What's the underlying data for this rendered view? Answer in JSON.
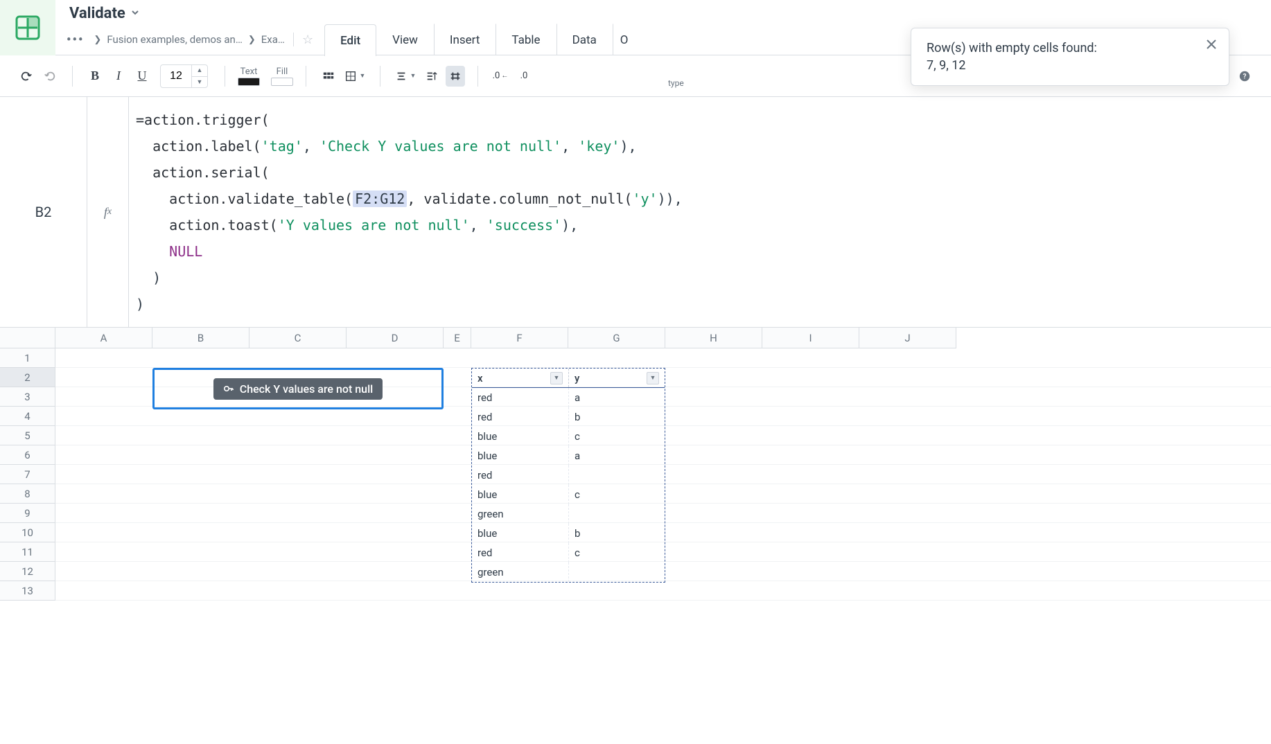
{
  "title": "Validate",
  "breadcrumbs": [
    "Fusion examples, demos an…",
    "Exa…"
  ],
  "tabs": [
    "Edit",
    "View",
    "Insert",
    "Table",
    "Data",
    "O"
  ],
  "active_tab": 0,
  "toolbar": {
    "font_size": "12",
    "text_label": "Text",
    "fill_label": "Fill",
    "decimals_left": ".0",
    "decimals_right": ".0",
    "type_label": "type"
  },
  "toast": {
    "title": "Row(s) with empty cells found:",
    "body": "7, 9, 12"
  },
  "cell_ref": "B2",
  "formula": {
    "line1_a": "=action.trigger(",
    "line2_a": "  action.label(",
    "line2_s1": "'tag'",
    "line2_b": ", ",
    "line2_s2": "'Check Y values are not null'",
    "line2_c": ", ",
    "line2_s3": "'key'",
    "line2_d": "),",
    "line3_a": "  action.serial(",
    "line4_a": "    action.validate_table(",
    "line4_range": "F2:G12",
    "line4_b": ", validate.column_not_null(",
    "line4_s1": "'y'",
    "line4_c": ")),",
    "line5_a": "    action.toast(",
    "line5_s1": "'Y values are not null'",
    "line5_b": ", ",
    "line5_s2": "'success'",
    "line5_c": "),",
    "line6_kw": "    NULL",
    "line7": "  )",
    "line8": ")"
  },
  "columns": [
    "A",
    "B",
    "C",
    "D",
    "E",
    "F",
    "G",
    "H",
    "I",
    "J"
  ],
  "row_numbers": [
    "1",
    "2",
    "3",
    "4",
    "5",
    "6",
    "7",
    "8",
    "9",
    "10",
    "11",
    "12",
    "13"
  ],
  "selected_row": 2,
  "validate_button": "Check Y values are not null",
  "table": {
    "headers": [
      "x",
      "y"
    ],
    "rows": [
      [
        "red",
        "a"
      ],
      [
        "red",
        "b"
      ],
      [
        "blue",
        "c"
      ],
      [
        "blue",
        "a"
      ],
      [
        "red",
        ""
      ],
      [
        "blue",
        "c"
      ],
      [
        "green",
        ""
      ],
      [
        "blue",
        "b"
      ],
      [
        "red",
        "c"
      ],
      [
        "green",
        ""
      ]
    ]
  }
}
